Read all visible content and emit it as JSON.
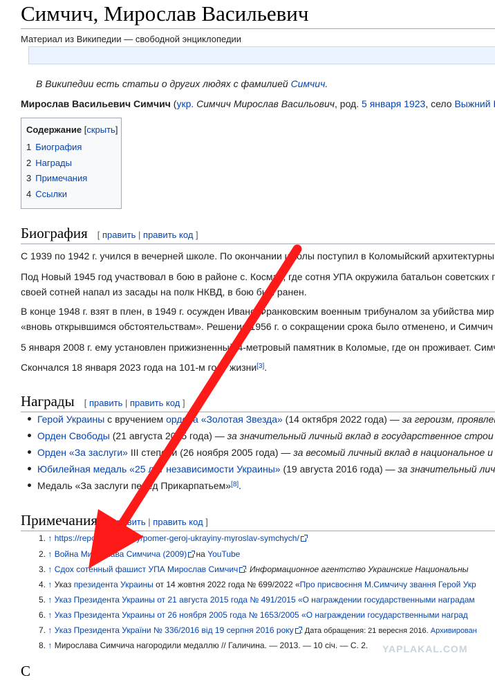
{
  "page": {
    "title": "Симчич, Мирослав Васильевич",
    "tagline": "Материал из Википедии — свободной энциклопедии"
  },
  "hatnote": {
    "text": "В Википедии есть статьи о других людях с фамилией ",
    "link": "Симчич",
    "end": "."
  },
  "lead": {
    "bold": "Мирослав Васильевич Симчич",
    "t1": " (",
    "lang_link": "укр.",
    "t2": " Симчич Мирослав Васильович",
    "t3": ", род. ",
    "date_link": "5 января 1923",
    "t4": ", село ",
    "place_link": "Выжний Б"
  },
  "toc": {
    "title": "Содержание",
    "hide": "скрыть",
    "items": [
      {
        "num": "1",
        "label": "Биография"
      },
      {
        "num": "2",
        "label": "Награды"
      },
      {
        "num": "3",
        "label": "Примечания"
      },
      {
        "num": "4",
        "label": "Ссылки"
      }
    ]
  },
  "edit_links": {
    "edit": "править",
    "edit_code": "править код"
  },
  "biography": {
    "heading": "Биография",
    "lines": [
      "С 1939 по 1942 г. учился в вечерней школе. По окончании школы поступил в Коломыйский архитектурны",
      "Под Новый 1945 год участвовал в бою в районе с. Космач, где сотня УПА окружила батальон советских п",
      "своей сотней напал из засады на полк НКВД, в бою был ранен.",
      "В конце 1948 г. взят в плен, в 1949 г. осужден Ивано-Франковским военным трибуналом за убийства мир",
      "«вновь открывшимся обстоятельствам». Решение 1956 г. о сокращении срока было отменено, и Симчич",
      "5 января 2008 г. ему установлен прижизненный 4-метровый памятник в Коломые, где он проживает. Симч",
      "Скончался 18 января 2023 года на 101-м году жизни"
    ],
    "sup": "[3]",
    "end": "."
  },
  "awards": {
    "heading": "Награды",
    "items": [
      {
        "link": "Герой Украины",
        "t1": " с вручением ",
        "link2": "ордена «Золотая Звезда»",
        "t2": " (14 октября 2022 года) — ",
        "it": "за героизм, проявлен"
      },
      {
        "link": "Орден Свободы",
        "t1": " (21 августа 2015 года) — ",
        "link2": "",
        "t2": "",
        "it": "за значительный личный вклад в государственное строи"
      },
      {
        "link": "Орден «За заслуги»",
        "t1": " III степени (26 ноября 2005 года) — ",
        "link2": "",
        "t2": "",
        "it": "за весомый личный вклад в национальное и"
      },
      {
        "link": "Юбилейная медаль «25 лет независимости Украины»",
        "t1": " (19 августа 2016 года) — ",
        "link2": "",
        "t2": "",
        "it": "за значительный личн"
      },
      {
        "link": "",
        "t1": "Медаль «За заслуги перед Прикарпатьем»",
        "link2": "",
        "t2": "",
        "it": "",
        "sup": "[8]",
        "end": "."
      }
    ]
  },
  "notes": {
    "heading": "Примечания",
    "arrow": "↑",
    "items": [
      {
        "num": "1.",
        "link": "https://report.if.ua/lyudy/pomer-geroj-ukrayiny-myroslav-symchych/",
        "rest": ""
      },
      {
        "num": "2.",
        "t": "Война Мирослава Симчича (2009)",
        "mid": " на ",
        "link2": "YouTube"
      },
      {
        "num": "3.",
        "link": "Сдох сотенный фашист УПА Мирослав Симчич",
        "rest": ". Информационное агентство Украинские Национальны"
      },
      {
        "num": "4.",
        "t": "Указ ",
        "link": "президента Украины",
        "rest": " от 14 жовтня 2022 года № 699/2022 «",
        "link2": "Про присвоєння М.Симчичу звання Герой Укр"
      },
      {
        "num": "5.",
        "link": "Указ Президента Украины от 21 августа 2015 года № 491/2015 «О награждении государственными наградам"
      },
      {
        "num": "6.",
        "link": "Указ Президента Украины от 26 ноября 2005 года № 1653/2005 «О награждении государственными наград"
      },
      {
        "num": "7.",
        "link": "Указ Президента України № 336/2016 від 19 серпня 2016 року",
        "rest": ". Дата обращения: 21 вересня 2016. ",
        "link2": "Архивирован"
      },
      {
        "num": "8.",
        "t": "Мирослава Симчича нагородили медаллю // Галичина. — 2013. — 10 січ. — С. 2."
      }
    ]
  },
  "next_heading": "С",
  "watermark": "YAPLAKAL.COM",
  "colors": {
    "link": "#0645ad",
    "arrow": "#ff1a1a",
    "notice_bg": "#eaf3ff",
    "toc_bg": "#f8f9fa"
  }
}
